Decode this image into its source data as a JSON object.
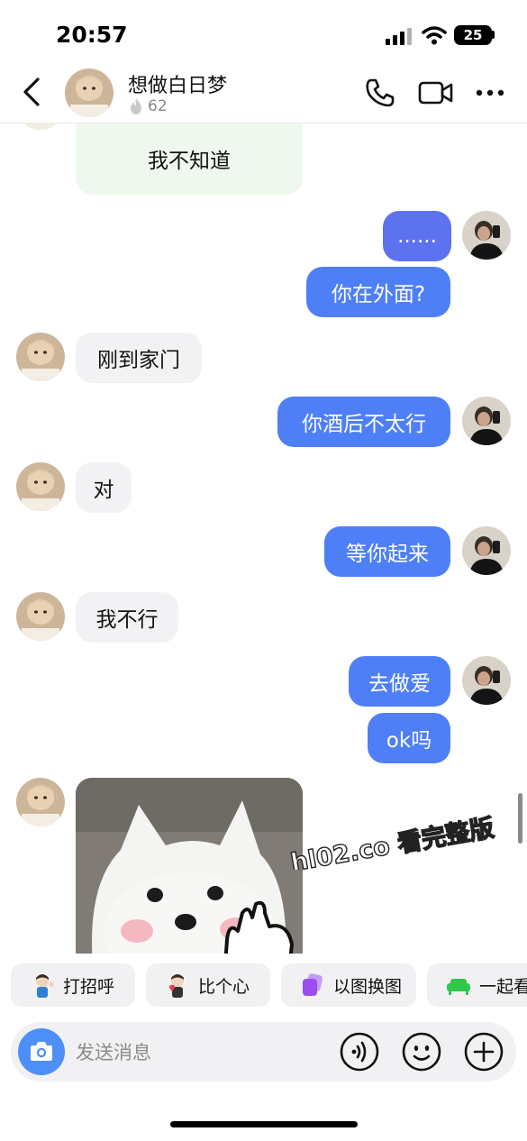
{
  "status_bar": {
    "time": "20:57",
    "battery": "25",
    "icons": [
      "signal-icon",
      "wifi-icon",
      "battery-icon"
    ]
  },
  "header": {
    "name": "想做白日梦",
    "streak_count": "62",
    "icons": [
      "back-chevron-icon",
      "flame-icon",
      "phone-icon",
      "video-camera-icon",
      "more-dots-icon"
    ]
  },
  "messages": [
    {
      "sender": "contact",
      "text": "我不知道"
    },
    {
      "sender": "me",
      "text": "......"
    },
    {
      "sender": "me",
      "text": "你在外面?"
    },
    {
      "sender": "contact",
      "text": "刚到家门"
    },
    {
      "sender": "me",
      "text": "你酒后不太行"
    },
    {
      "sender": "contact",
      "text": "对"
    },
    {
      "sender": "me",
      "text": "等你起来"
    },
    {
      "sender": "contact",
      "text": "我不行"
    },
    {
      "sender": "me",
      "text": "去做爱"
    },
    {
      "sender": "me",
      "text": "ok吗"
    },
    {
      "sender": "contact",
      "type": "sticker",
      "icon": "white-dog-sticker"
    }
  ],
  "watermark": "hl02.co 看完整版",
  "quick_actions": [
    {
      "label": "打招呼",
      "icon": "wave-avatar-icon"
    },
    {
      "label": "比个心",
      "icon": "heart-avatar-icon"
    },
    {
      "label": "以图换图",
      "icon": "photo-swap-icon",
      "color": "#9b4df0"
    },
    {
      "label": "一起看",
      "icon": "sofa-icon",
      "color": "#2fc84a"
    }
  ],
  "input": {
    "placeholder": "发送消息",
    "icons": [
      "camera-icon",
      "voice-icon",
      "emoji-icon",
      "plus-icon"
    ]
  },
  "colors": {
    "outgoing_bubble": "#4f7ff7",
    "incoming_bubble": "#f2f2f4",
    "camera_button": "#4d8ff6"
  }
}
